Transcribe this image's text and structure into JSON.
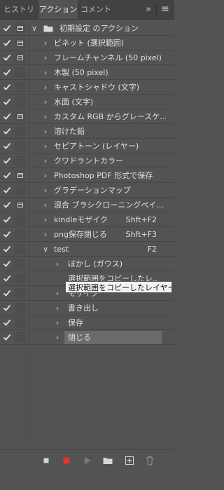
{
  "tabs": [
    {
      "label": "ヒストリー",
      "active": false
    },
    {
      "label": "アクション",
      "active": true
    },
    {
      "label": "コメント",
      "active": false
    }
  ],
  "panel_controls": {
    "collapse": "»",
    "menu": "≡"
  },
  "set": {
    "name": "初期設定 のアクション"
  },
  "actions": [
    {
      "label": "ビネット (選択範囲)",
      "dialog": true
    },
    {
      "label": "フレームチャンネル (50 pixel)",
      "dialog": true
    },
    {
      "label": "木製 (50 pixel)",
      "dialog": false
    },
    {
      "label": "キャストシャドウ (文字)",
      "dialog": false
    },
    {
      "label": "水面 (文字)",
      "dialog": false
    },
    {
      "label": "カスタム RGB からグレースケ...",
      "dialog": true
    },
    {
      "label": "溶けた鉛",
      "dialog": false
    },
    {
      "label": "セピアトーン (レイヤー)",
      "dialog": false
    },
    {
      "label": "クワドラントカラー",
      "dialog": false
    },
    {
      "label": "Photoshop PDF 形式で保存",
      "dialog": true
    },
    {
      "label": "グラデーションマップ",
      "dialog": false
    },
    {
      "label": "混合 ブラシクローニングペイ...",
      "dialog": true
    },
    {
      "label": "kindleモザイク",
      "dialog": false,
      "shortcut": "Shft+F2"
    },
    {
      "label": "png保存閉じる",
      "dialog": false,
      "shortcut": "Shft+F3"
    }
  ],
  "test_action": {
    "label": "test",
    "shortcut": "F2"
  },
  "steps": [
    {
      "label": "ぼかし (ガウス)",
      "expandable": true
    },
    {
      "label": "選択範囲をコピーしたレ...",
      "expandable": false
    },
    {
      "label": "モザイク",
      "expandable": true
    },
    {
      "label": "書き出し",
      "expandable": true
    },
    {
      "label": "保存",
      "expandable": true
    },
    {
      "label": "閉じる",
      "expandable": true,
      "selected": true
    }
  ],
  "tooltip": "選択範囲をコピーしたレイヤー",
  "colors": {
    "panel": "#535353",
    "tab_bar": "#424242",
    "record": "#e8302a",
    "highlight": "#6b6b6b"
  },
  "bottom_buttons": [
    "stop-icon",
    "record-icon",
    "play-icon",
    "new-set-folder-icon",
    "new-action-icon",
    "trash-icon"
  ]
}
